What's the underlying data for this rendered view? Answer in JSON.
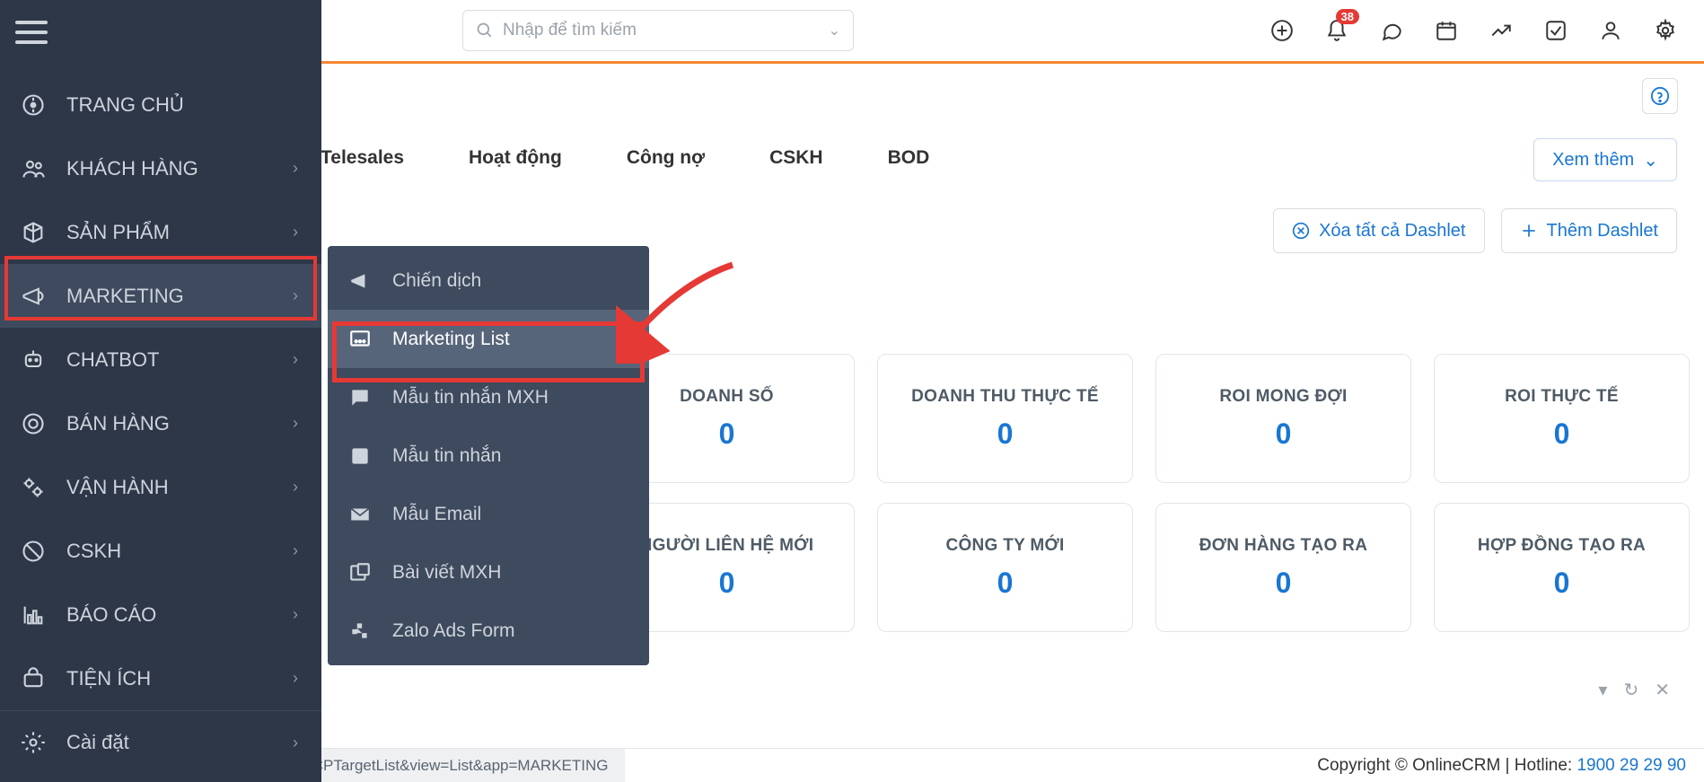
{
  "search": {
    "placeholder": "Nhập để tìm kiếm"
  },
  "topbar": {
    "notif_badge": "38"
  },
  "help": {
    "icon": "?"
  },
  "tabs": {
    "telesales": "Telesales",
    "activity": "Hoạt động",
    "debt": "Công nợ",
    "cskh": "CSKH",
    "bod": "BOD"
  },
  "viewmore": {
    "label": "Xem thêm"
  },
  "actions": {
    "delete": "Xóa tất cả Dashlet",
    "add": "Thêm Dashlet"
  },
  "sidebar": {
    "home": "TRANG CHỦ",
    "customer": "KHÁCH HÀNG",
    "product": "SẢN PHẨM",
    "marketing": "MARKETING",
    "chatbot": "CHATBOT",
    "sales": "BÁN HÀNG",
    "operate": "VẬN HÀNH",
    "cskh": "CSKH",
    "report": "BÁO CÁO",
    "utility": "TIỆN ÍCH",
    "settings": "Cài đặt"
  },
  "submenu": {
    "campaign": "Chiến dịch",
    "mlist": "Marketing List",
    "smstpl": "Mẫu tin nhắn MXH",
    "msgtpl": "Mẫu tin nhắn",
    "emailtpl": "Mẫu Email",
    "social": "Bài viết MXH",
    "zalo": "Zalo Ads Form"
  },
  "metrics": [
    {
      "t": "DOANH SỐ",
      "v": "0"
    },
    {
      "t": "DOANH THU THỰC TẾ",
      "v": "0"
    },
    {
      "t": "ROI MONG ĐỢI",
      "v": "0"
    },
    {
      "t": "ROI THỰC TẾ",
      "v": "0"
    }
  ],
  "metrics2": [
    {
      "t": "NGƯỜI LIÊN HỆ MỚI",
      "v": "0"
    },
    {
      "t": "CÔNG TY MỚI",
      "v": "0"
    },
    {
      "t": "ĐƠN HÀNG TẠO RA",
      "v": "0"
    },
    {
      "t": "HỢP ĐỒNG TẠO RA",
      "v": "0"
    }
  ],
  "footer": {
    "status": "https://demo.cloudpro.vn/index.php?module=CPTargetList&view=List&app=MARKETING",
    "copyright": "Copyright © OnlineCRM | Hotline: ",
    "hotline": "1900 29 29 90"
  }
}
